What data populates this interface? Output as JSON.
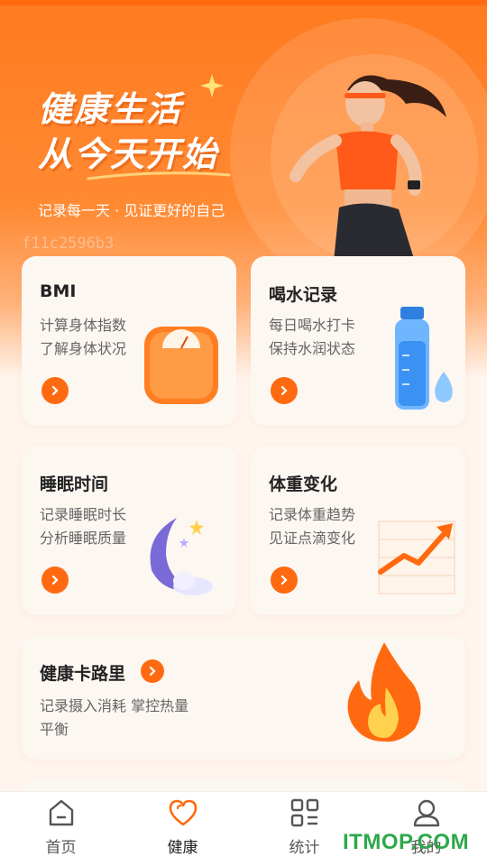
{
  "hero": {
    "title_line1": "健康生活",
    "title_line2": "从今天开始",
    "subtitle": "记录每一天 · 见证更好的自己",
    "watermark_code": "f11c2596b3"
  },
  "cards": [
    {
      "title": "BMI",
      "desc1": "计算身体指数",
      "desc2": "了解身体状况",
      "icon": "scale-icon"
    },
    {
      "title": "喝水记录",
      "desc1": "每日喝水打卡",
      "desc2": "保持水润状态",
      "icon": "water-bottle-icon"
    },
    {
      "title": "睡眠时间",
      "desc1": "记录睡眠时长",
      "desc2": "分析睡眠质量",
      "icon": "moon-icon"
    },
    {
      "title": "体重变化",
      "desc1": "记录体重趋势",
      "desc2": "见证点滴变化",
      "icon": "trend-chart-icon"
    }
  ],
  "calorie_card": {
    "title": "健康卡路里",
    "desc1": "记录摄入消耗 掌控热量",
    "desc2": "平衡",
    "icon": "flame-icon"
  },
  "tabbar": {
    "items": [
      {
        "label": "首页",
        "icon": "home-icon"
      },
      {
        "label": "健康",
        "icon": "heart-icon",
        "active": true
      },
      {
        "label": "统计",
        "icon": "grid-icon"
      },
      {
        "label": "我的",
        "icon": "user-icon"
      }
    ]
  },
  "overlay_watermark": "ITMOP.COM",
  "colors": {
    "accent": "#ff6a10",
    "card_bg": "#fdf7f2",
    "page_bg": "#fff5ee"
  }
}
